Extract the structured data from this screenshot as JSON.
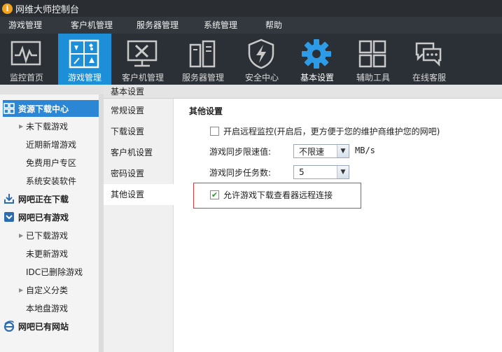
{
  "app": {
    "title": "网维大师控制台",
    "logo_glyph": "i"
  },
  "menubar": [
    "游戏管理",
    "客户机管理",
    "服务器管理",
    "系统管理",
    "帮助"
  ],
  "toolbar": [
    {
      "label": "监控首页",
      "icon": "monitor-pulse-icon"
    },
    {
      "label": "游戏管理",
      "icon": "gamepad-grid-icon"
    },
    {
      "label": "客户机管理",
      "icon": "tools-monitor-icon"
    },
    {
      "label": "服务器管理",
      "icon": "server-icon"
    },
    {
      "label": "安全中心",
      "icon": "shield-bolt-icon"
    },
    {
      "label": "基本设置",
      "icon": "gear-icon"
    },
    {
      "label": "辅助工具",
      "icon": "four-squares-icon"
    },
    {
      "label": "在线客服",
      "icon": "chat-bubbles-icon"
    }
  ],
  "sidebar": {
    "sections": [
      {
        "label": "资源下载中心",
        "icon": "grid-icon",
        "items": [
          {
            "label": "未下载游戏",
            "expandable": true
          },
          {
            "label": "近期新增游戏"
          },
          {
            "label": "免费用户专区"
          },
          {
            "label": "系统安装软件"
          }
        ]
      },
      {
        "label": "网吧正在下载",
        "icon": "download-tray-icon",
        "items": []
      },
      {
        "label": "网吧已有游戏",
        "icon": "box-down-icon",
        "items": [
          {
            "label": "已下载游戏",
            "expandable": true
          },
          {
            "label": "未更新游戏"
          },
          {
            "label": "IDC已删除游戏"
          },
          {
            "label": "自定义分类",
            "expandable": true
          },
          {
            "label": "本地盘游戏"
          }
        ]
      },
      {
        "label": "网吧已有网站",
        "icon": "ie-icon",
        "items": []
      }
    ]
  },
  "panel": {
    "title": "基本设置",
    "subnav": [
      "常规设置",
      "下载设置",
      "客户机设置",
      "密码设置",
      "其他设置"
    ],
    "section_title": "其他设置",
    "remote_monitor": {
      "label": "开启远程监控(开启后，更方便于您的维护商维护您的网吧)",
      "checked": false
    },
    "speed_limit": {
      "label": "游戏同步限速值:",
      "value": "不限速",
      "unit": "MB/s"
    },
    "task_count": {
      "label": "游戏同步任务数:",
      "value": "5"
    },
    "allow_remote": {
      "label": "允许游戏下载查看器远程连接",
      "checked": true
    }
  },
  "colors": {
    "accent": "#1d8ed8",
    "highlight_border": "#e23a3a",
    "toolbar_bg": "#2b3036"
  }
}
